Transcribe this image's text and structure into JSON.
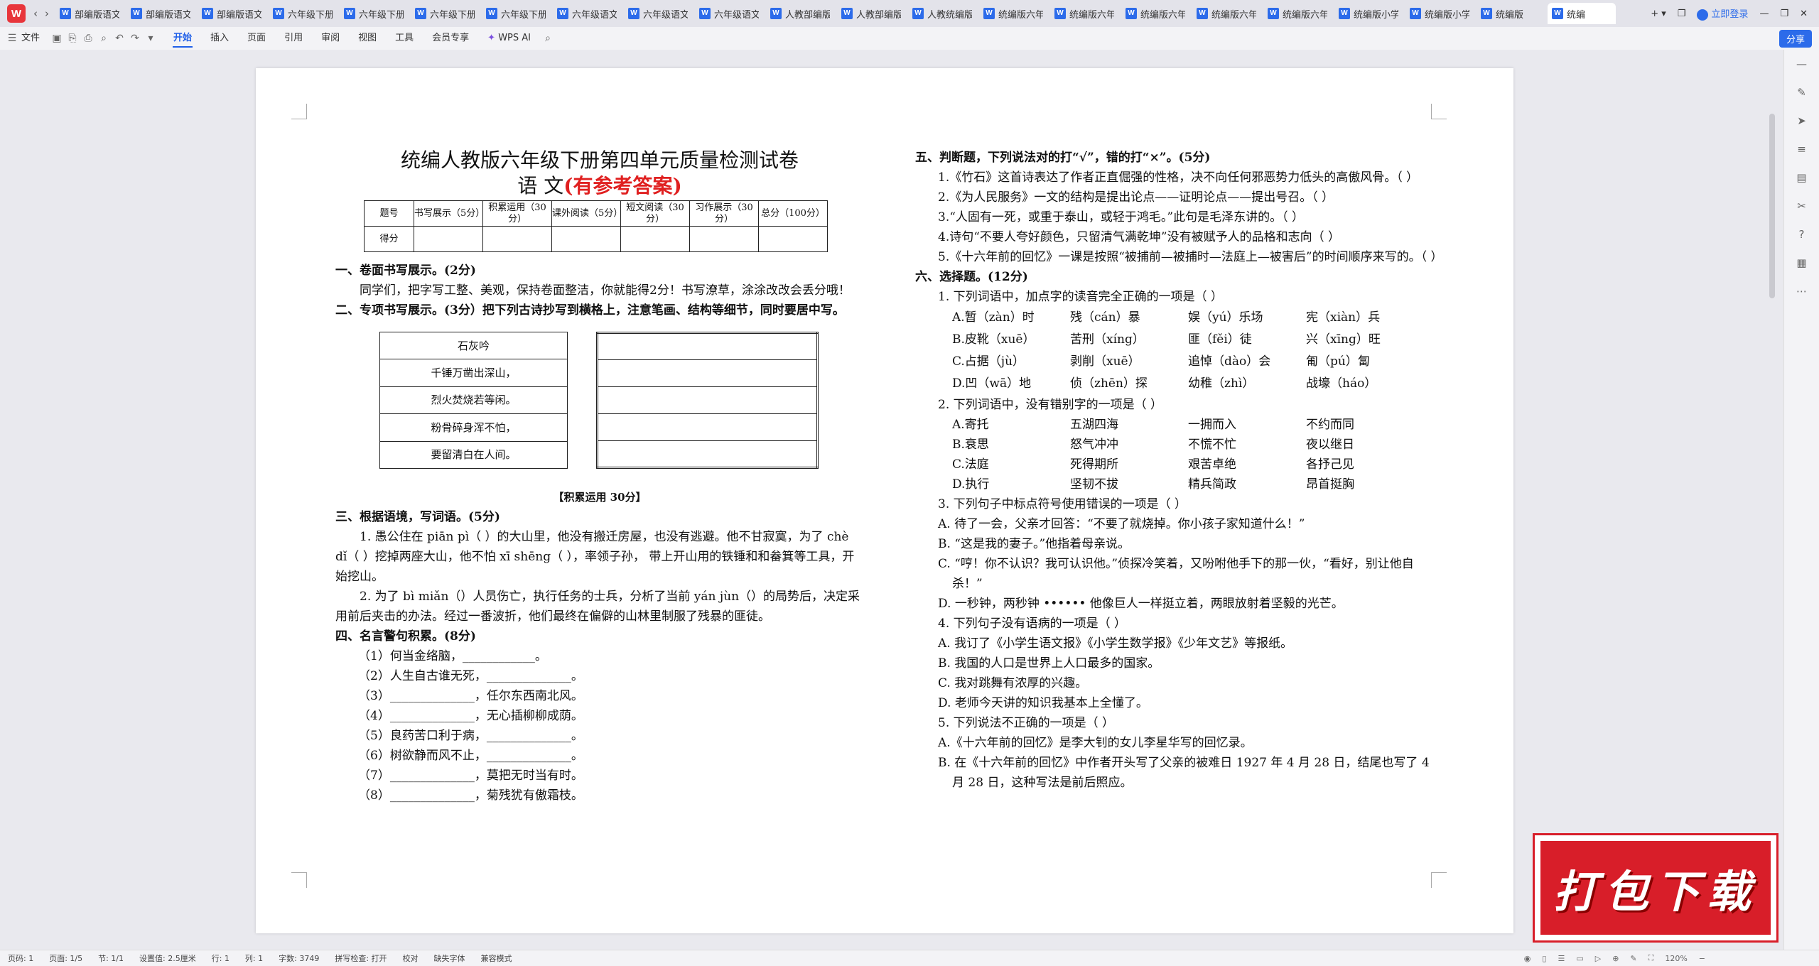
{
  "tabs": [
    "部编版语文",
    "部编版语文",
    "部编版语文",
    "六年级下册",
    "六年级下册",
    "六年级下册",
    "六年级下册",
    "六年级语文",
    "六年级语文",
    "六年级语文",
    "人教部编版",
    "人教部编版",
    "人教统编版",
    "统编版六年",
    "统编版六年",
    "统编版六年",
    "统编版六年",
    "统编版六年",
    "统编版小学",
    "统编版小学",
    "统编版",
    "统编"
  ],
  "topbar": {
    "login": "立即登录"
  },
  "menu": {
    "file": "文件",
    "items": [
      "开始",
      "插入",
      "页面",
      "引用",
      "审阅",
      "视图",
      "工具",
      "会员专享"
    ],
    "wpsai": "WPS AI",
    "share": "分享"
  },
  "doc": {
    "title": "统编人教版六年级下册第四单元质量检测试卷",
    "subtitle": "语  文",
    "subtitle_red": "(有参考答案)",
    "score_head": [
      "题号",
      "书写展示（5分）",
      "积累运用（30分）",
      "课外阅读（5分）",
      "短文阅读（30分）",
      "习作展示（30分）",
      "总分（100分）"
    ],
    "score_row": "得分",
    "s1": "一、卷面书写展示。(2分)",
    "s1p": "同学们，把字写工整、美观，保持卷面整洁，你就能得2分！书写潦草，涂涂改改会丢分哦！",
    "s2": "二、专项书写展示。(3分）把下列古诗抄写到横格上，注意笔画、结构等细节，同时要居中写。",
    "poem": [
      "石灰吟",
      "千锤万凿出深山，",
      "烈火焚烧若等闲。",
      "粉骨碎身浑不怕，",
      "要留清白在人间。"
    ],
    "acc": "【积累运用 30分】",
    "s3": "三、根据语境，写词语。(5分)",
    "s3p1": "1. 愚公住在 piān pì（    ）的大山里，他没有搬迁房屋，也没有逃避。他不甘寂寞，为了 chè dǐ（    ）挖掉两座大山，他不怕 xī shēng（    ），率领子孙， 带上开山用的铁锤和和畚箕等工具，开始挖山。",
    "s3p2": "2. 为了 bì miǎn（）人员伤亡，执行任务的士兵，分析了当前 yán jùn（）的局势后，决定采用前后夹击的办法。经过一番波折，他们最终在偏僻的山林里制服了残暴的匪徒。",
    "s4": "四、名言警句积累。(8分)",
    "s4items": [
      "（1）何当金络脑，____________。",
      "（2）人生自古谁无死，______________。",
      "（3）______________，任尔东西南北风。",
      "（4）______________，无心插柳柳成荫。",
      "（5）良药苦口利于病，______________。",
      "（6）树欲静而风不止，______________。",
      "（7）______________，莫把无时当有时。",
      "（8）______________，菊残犹有傲霜枝。"
    ],
    "s5": "五、判断题，下列说法对的打“√”，错的打“×”。(5分)",
    "s5items": [
      "1.《竹石》这首诗表达了作者正直倔强的性格，决不向任何邪恶势力低头的高傲风骨。（    ）",
      "2.《为人民服务》一文的结构是提出论点——证明论点——提出号召。（    ）",
      "3.“人固有一死，或重于泰山，或轻于鸿毛。”此句是毛泽东讲的。（    ）",
      "4.诗句“不要人夸好颜色，只留清气满乾坤”没有被赋予人的品格和志向（    ）",
      "5.《十六年前的回忆》一课是按照“被捕前—被捕时—法庭上—被害后”的时间顺序来写的。（    ）"
    ],
    "s6": "六、选择题。(12分)",
    "q1": "1. 下列词语中，加点字的读音完全正确的一项是（      ）",
    "q1opts": [
      [
        "A.暂（zàn）时",
        "残（cán）暴",
        "娱（yú）乐场",
        "宪（xiàn）兵"
      ],
      [
        "B.皮靴（xuē）",
        "苦刑（xíng）",
        "匪（fěi）徒",
        "兴（xīng）旺"
      ],
      [
        "C.占据（jù）",
        "剥削（xuē）",
        "追悼（dào）会",
        "匍（pú）匐"
      ],
      [
        "D.凹（wā）地",
        "侦（zhēn）探",
        "幼稚（zhì）",
        "战壕（háo）"
      ]
    ],
    "q2": "2. 下列词语中，没有错别字的一项是（      ）",
    "q2opts": [
      [
        "A.寄托",
        "五湖四海",
        "一拥而入",
        "不约而同"
      ],
      [
        "B.衰思",
        "怒气冲冲",
        "不慌不忙",
        "夜以继日"
      ],
      [
        "C.法庭",
        "死得期所",
        "艰苦卓绝",
        "各抒己见"
      ],
      [
        "D.执行",
        "坚韧不拔",
        "精兵简政",
        "昂首挺胸"
      ]
    ],
    "q3": "3. 下列句子中标点符号使用错误的一项是（      ）",
    "q3opts": [
      "A. 待了一会，父亲才回答：“不要了就烧掉。你小孩子家知道什么！”",
      "B. “这是我的妻子。”他指着母亲说。",
      "C. “哼！你不认识？我可认识他。”侦探冷笑着，又吩咐他手下的那一伙，“看好，别让他自杀！”",
      "D. 一秒钟，两秒钟 •••••• 他像巨人一样挺立着，两眼放射着坚毅的光芒。"
    ],
    "q4": "4. 下列句子没有语病的一项是（      ）",
    "q4opts": [
      "A. 我订了《小学生语文报》《小学生数学报》《少年文艺》等报纸。",
      "B. 我国的人口是世界上人口最多的国家。",
      "C. 我对跳舞有浓厚的兴趣。",
      "D. 老师今天讲的知识我基本上全懂了。"
    ],
    "q5": "5. 下列说法不正确的一项是（      ）",
    "q5opts": [
      "A.《十六年前的回忆》是李大钊的女儿李星华写的回忆录。",
      "B. 在《十六年前的回忆》中作者开头写了父亲的被难日 1927 年 4 月 28 日，结尾也写了 4 月 28 日，这种写法是前后照应。"
    ]
  },
  "status": [
    "页码: 1",
    "页面: 1/5",
    "节: 1/1",
    "设置值: 2.5厘米",
    "行: 1",
    "列: 1",
    "字数: 3749",
    "拼写检查: 打开",
    "校对",
    "缺失字体",
    "兼容模式"
  ],
  "zoom": "120%",
  "promo": "打包下载"
}
